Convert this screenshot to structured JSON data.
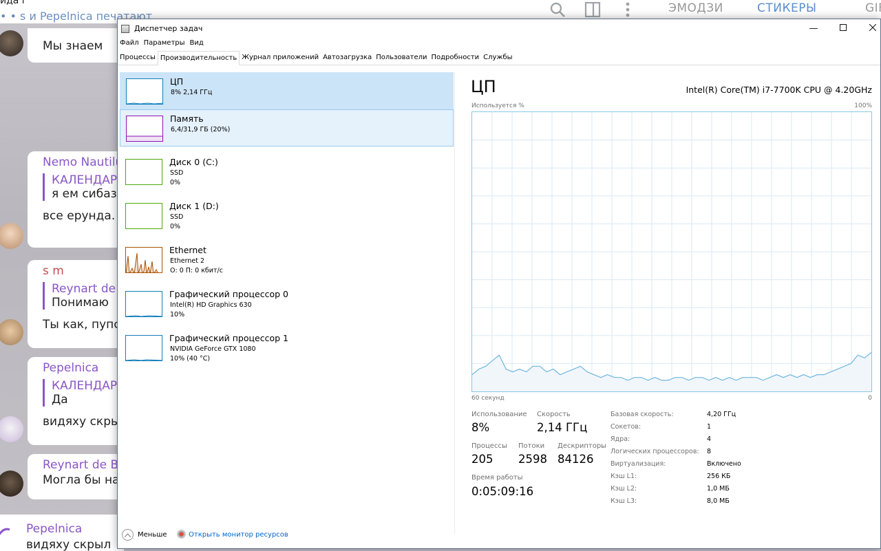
{
  "telegram": {
    "chat_title": "ида г",
    "typing": "• • s и Pepelnica печатают",
    "tabs": [
      "ЭМОДЗИ",
      "СТИКЕРЫ",
      "GIF"
    ],
    "messages": [
      {
        "author": "",
        "text": "Мы знаем"
      },
      {
        "author": "Nemo Nautilus",
        "quote_name": "КАЛЕНДАРЬ",
        "quote_text": "я ем сибазон",
        "text": "все ерунда. н"
      },
      {
        "author": "s m",
        "quote_name": "Reynart de",
        "quote_text": "Понимаю",
        "text": "Ты как, пупс?"
      },
      {
        "author": "Pepelnica",
        "quote_name": "КАЛЕНДАРЬ",
        "quote_text": "Да",
        "text": "видяху скрыл"
      },
      {
        "author": "Reynart de Bu",
        "text": "Могла бы наг"
      },
      {
        "author": "Pepelnica",
        "text": "видяху скрыл"
      }
    ]
  },
  "taskmgr": {
    "window_title": "Диспетчер задач",
    "menu": [
      "Файл",
      "Параметры",
      "Вид"
    ],
    "tabs": [
      "Процессы",
      "Производительность",
      "Журнал приложений",
      "Автозагрузка",
      "Пользователи",
      "Подробности",
      "Службы"
    ],
    "active_tab": "Производительность",
    "devices": [
      {
        "name": "ЦП",
        "sub": "8% 2,14 ГГц",
        "sub2": "",
        "color": "#117dbb"
      },
      {
        "name": "Память",
        "sub": "6,4/31,9 ГБ (20%)",
        "sub2": "",
        "color": "#8b12ae"
      },
      {
        "name": "Диск 0 (C:)",
        "sub": "SSD",
        "sub2": "0%",
        "color": "#4da60c"
      },
      {
        "name": "Диск 1 (D:)",
        "sub": "SSD",
        "sub2": "0%",
        "color": "#4da60c"
      },
      {
        "name": "Ethernet",
        "sub": "Ethernet 2",
        "sub2": "О: 0 П: 0 кбит/с",
        "color": "#a74f01"
      },
      {
        "name": "Графический процессор 0",
        "sub": "Intel(R) HD Graphics 630",
        "sub2": "10%",
        "color": "#117dbb"
      },
      {
        "name": "Графический процессор 1",
        "sub": "NVIDIA GeForce GTX 1080",
        "sub2": "10% (40 °C)",
        "color": "#117dbb"
      }
    ],
    "cpu": {
      "title": "ЦП",
      "model": "Intel(R) Core(TM) i7-7700K CPU @ 4.20GHz",
      "axis_top_left": "Используется %",
      "axis_top_right": "100%",
      "axis_bottom_left": "60 секунд",
      "axis_bottom_right": "0",
      "utilization_history_percent": [
        6,
        8,
        9,
        11,
        13,
        8,
        7,
        8,
        7,
        9,
        9,
        7,
        8,
        6,
        7,
        8,
        9,
        7,
        6,
        5,
        6,
        5,
        5,
        4,
        5,
        5,
        4,
        5,
        4,
        4,
        5,
        5,
        4,
        5,
        5,
        4,
        5,
        4,
        5,
        4,
        5,
        5,
        5,
        4,
        5,
        6,
        5,
        6,
        5,
        6,
        5,
        6,
        6,
        7,
        8,
        9,
        10,
        13,
        12,
        14
      ],
      "stats": {
        "util_label": "Использование",
        "util": "8%",
        "speed_label": "Скорость",
        "speed": "2,14 ГГц",
        "proc_label": "Процессы",
        "proc": "205",
        "threads_label": "Потоки",
        "threads": "2598",
        "handles_label": "Дескрипторы",
        "handles": "84126",
        "uptime_label": "Время работы",
        "uptime": "0:05:09:16"
      },
      "specs": [
        {
          "k": "Базовая скорость:",
          "v": "4,20 ГГц"
        },
        {
          "k": "Сокетов:",
          "v": "1"
        },
        {
          "k": "Ядра:",
          "v": "4"
        },
        {
          "k": "Логических процессоров:",
          "v": "8"
        },
        {
          "k": "Виртуализация:",
          "v": "Включено"
        },
        {
          "k": "Кэш L1:",
          "v": "256 КБ"
        },
        {
          "k": "Кэш L2:",
          "v": "1,0 МБ"
        },
        {
          "k": "Кэш L3:",
          "v": "8,0 МБ"
        }
      ]
    },
    "footer": {
      "less": "Меньше",
      "monitor": "Открыть монитор ресурсов"
    }
  }
}
